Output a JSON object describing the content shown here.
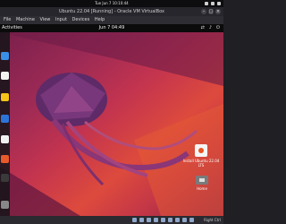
{
  "host": {
    "clock": "Tue Jun 7  10:10:44"
  },
  "window": {
    "title": "Ubuntu 22.04 [Running] - Oracle VM VirtualBox"
  },
  "menu": {
    "items": [
      "File",
      "Machine",
      "View",
      "Input",
      "Devices",
      "Help"
    ]
  },
  "guest": {
    "activities": "Activities",
    "clock": "Jun 7  04:49"
  },
  "desktop": {
    "install_label": "Install Ubuntu 22.04 LTS",
    "home_label": "Home"
  },
  "statusbar": {
    "host_key": "Right Ctrl"
  },
  "colors": {
    "wallpaper_start": "#7a1f4b",
    "wallpaper_end": "#dd4a3d",
    "accent": "#e95420"
  }
}
